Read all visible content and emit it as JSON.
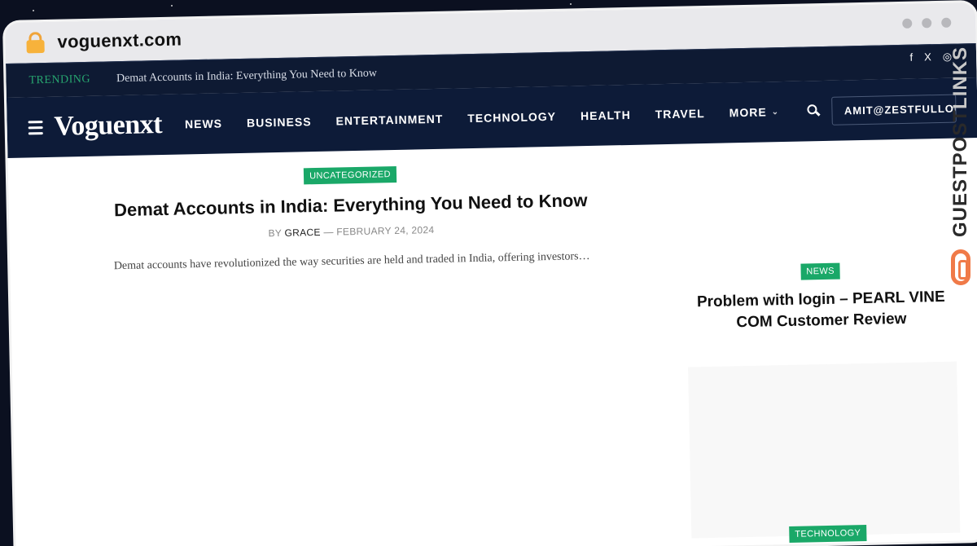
{
  "browser": {
    "url": "voguenxt.com"
  },
  "topbar": {
    "trending_label": "TRENDING",
    "trending_headline": "Demat Accounts in India: Everything You Need to Know",
    "social": [
      "f",
      "X",
      "◎"
    ]
  },
  "nav": {
    "logo": "Voguenxt",
    "items": [
      "NEWS",
      "BUSINESS",
      "ENTERTAINMENT",
      "TECHNOLOGY",
      "HEALTH",
      "TRAVEL",
      "MORE"
    ],
    "user": "AMIT@ZESTFULLOUTREA"
  },
  "main_post": {
    "category": "UNCATEGORIZED",
    "title": "Demat Accounts in India: Everything You Need to Know",
    "by": "BY",
    "author": "GRACE",
    "separator": "—",
    "date": "FEBRUARY 24, 2024",
    "excerpt": "Demat accounts have revolutionized the way securities are held and traded in India, offering investors…"
  },
  "sidebar": {
    "post1_category": "NEWS",
    "post1_title": "Problem with login – PEARL VINE COM Customer Review",
    "post2_category": "TECHNOLOGY"
  },
  "watermark": {
    "text_dark": "GUESTPOST",
    "text_light": "LINKS"
  },
  "colors": {
    "nav_bg": "#0d1b38",
    "accent_green": "#1aa868",
    "trending_green": "#27a56f"
  }
}
